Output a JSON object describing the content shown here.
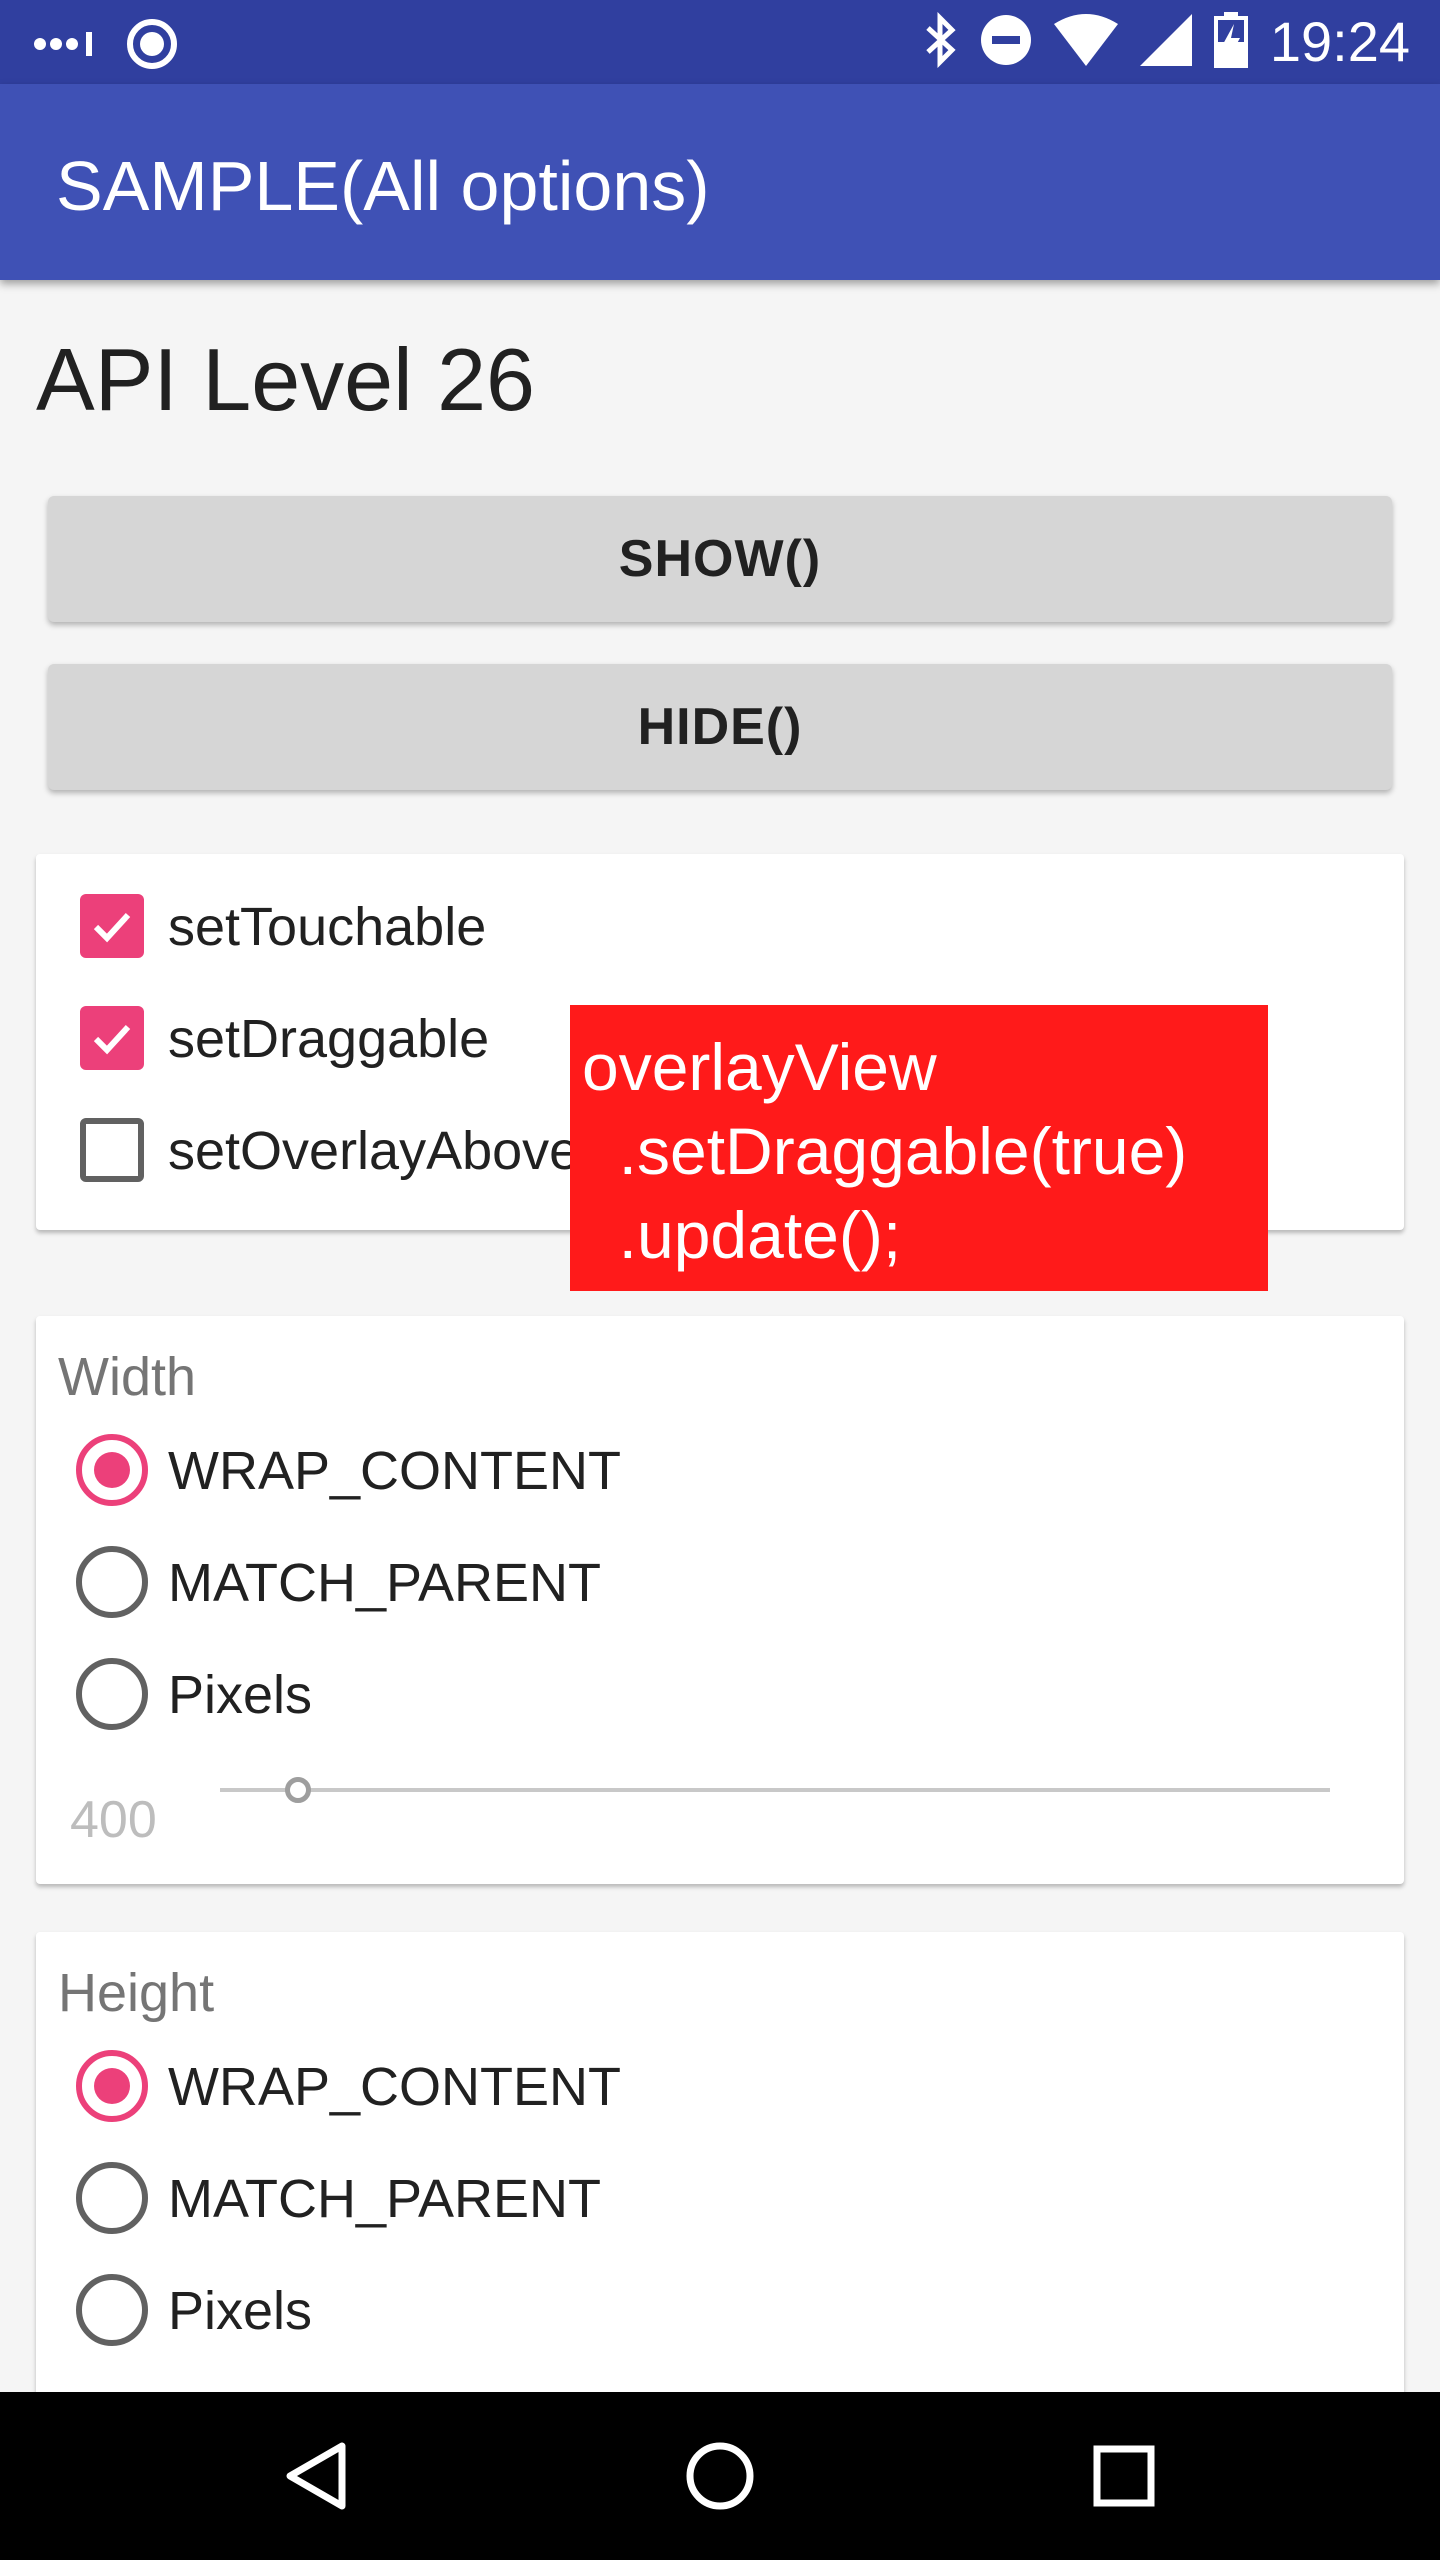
{
  "status_bar": {
    "time": "19:24",
    "icons": [
      "signal-dots-icon",
      "app-notification-icon",
      "bluetooth-icon",
      "do-not-disturb-icon",
      "wifi-icon",
      "cell-signal-icon",
      "battery-charging-icon"
    ]
  },
  "app_bar": {
    "title": "SAMPLE(All options)"
  },
  "api_level": "API Level 26",
  "buttons": {
    "show": "SHOW()",
    "hide": "HIDE()"
  },
  "options": [
    {
      "label": "setTouchable",
      "checked": true
    },
    {
      "label": "setDraggable",
      "checked": true
    },
    {
      "label": "setOverlayAboveNavigationBar",
      "checked": false
    }
  ],
  "width": {
    "title": "Width",
    "options": [
      "WRAP_CONTENT",
      "MATCH_PARENT",
      "Pixels"
    ],
    "selected": "WRAP_CONTENT",
    "pixels_value": "400",
    "slider_fraction": 0.07
  },
  "height": {
    "title": "Height",
    "options": [
      "WRAP_CONTENT",
      "MATCH_PARENT",
      "Pixels"
    ],
    "selected": "WRAP_CONTENT"
  },
  "overlay": {
    "text": "overlayView\n  .setDraggable(true)\n  .update();"
  },
  "colors": {
    "primary": "#3f51b5",
    "primary_dark": "#303f9f",
    "accent": "#ec407a",
    "overlay": "#ff1a1a"
  },
  "nav_bar": {
    "icons": [
      "back-icon",
      "home-icon",
      "recents-icon"
    ]
  }
}
